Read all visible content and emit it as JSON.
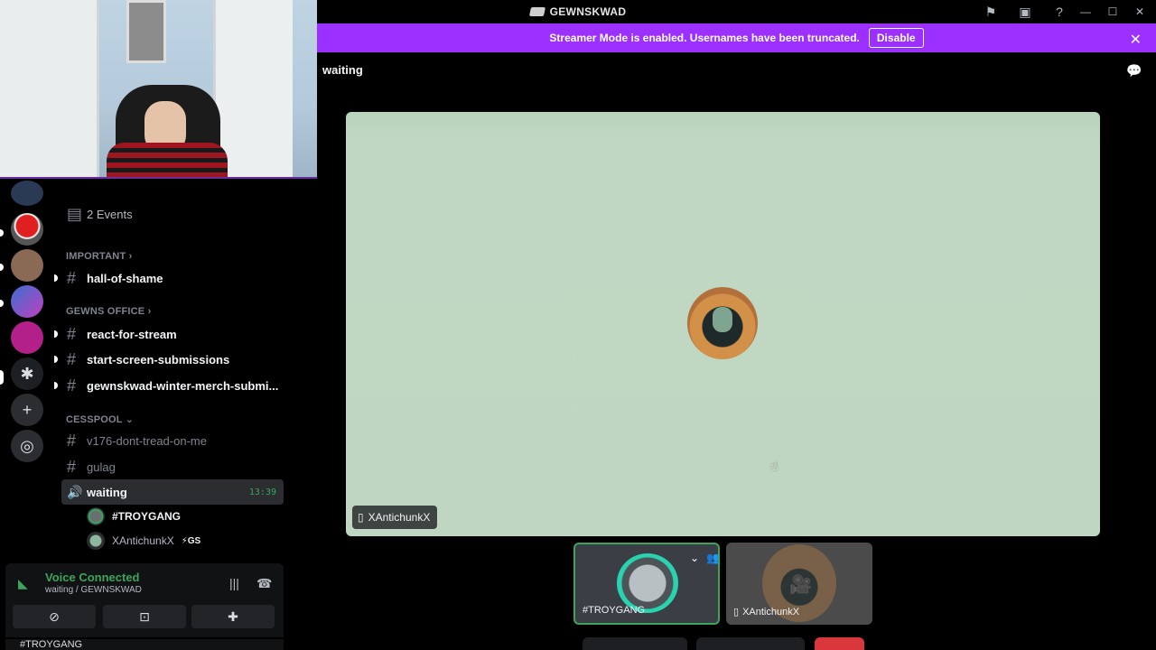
{
  "window": {
    "title": "GEWNSKWAD",
    "icons": [
      "flag-icon",
      "inbox-icon",
      "help-icon"
    ],
    "controls": [
      "minimize-icon",
      "maximize-icon",
      "close-icon"
    ]
  },
  "banner": {
    "message": "Streamer Mode is enabled. Usernames have been truncated.",
    "button": "Disable",
    "color": "#9b30ff"
  },
  "sidebar": {
    "events": "2 Events",
    "categories": [
      {
        "name": "IMPORTANT",
        "chevron": "›"
      },
      {
        "name": "GEWNS OFFICE",
        "chevron": "›"
      },
      {
        "name": "CESSPOOL",
        "chevron": "⌄"
      }
    ],
    "channels": {
      "hall": "hall-of-shame",
      "react": "react-for-stream",
      "start": "start-screen-submissions",
      "merch": "gewnskwad-winter-merch-submi...",
      "v176": "v176-dont-tread-on-me",
      "gulag": "gulag",
      "waiting": "waiting",
      "waiting_time": "13:39"
    },
    "members": [
      {
        "name": "#TROYGANG",
        "badge": ""
      },
      {
        "name": "XAntichunkX",
        "badge": "⚡GS"
      }
    ]
  },
  "voice": {
    "status": "Voice Connected",
    "location": "waiting / GEWNSKWAD"
  },
  "userbar": {
    "name": "#TROYGANG"
  },
  "main": {
    "channel": "waiting",
    "stage_name": "XAntichunkX",
    "tiles": [
      {
        "name": "#TROYGANG"
      },
      {
        "name": "XAntichunkX"
      }
    ]
  },
  "colors": {
    "accent_green": "#3ba55d",
    "stage_bg": "#bfd7c2"
  }
}
